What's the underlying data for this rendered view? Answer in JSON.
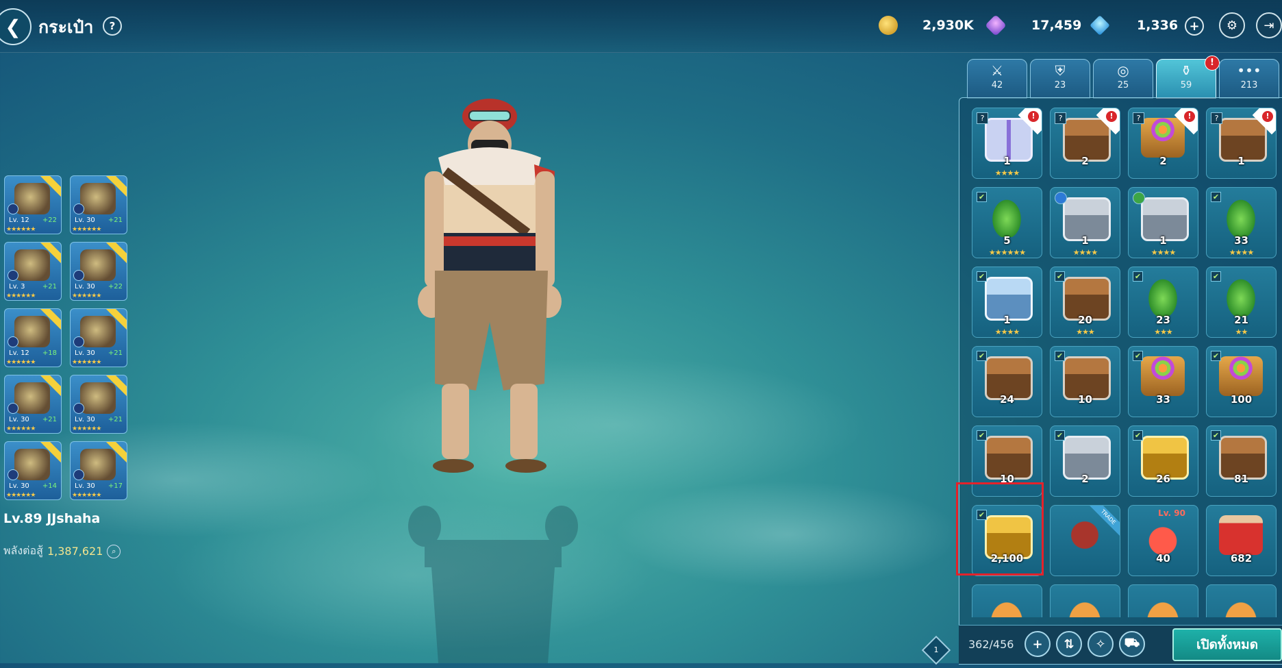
{
  "header": {
    "title": "กระเป๋า",
    "back_icon": "arrow-left-icon",
    "help_label": "?"
  },
  "currencies": [
    {
      "name": "gold",
      "value": "2,930K",
      "icon": "gold-coin-icon"
    },
    {
      "name": "crystal",
      "value": "17,459",
      "icon": "purple-crystal-icon"
    },
    {
      "name": "diamond",
      "value": "1,336",
      "icon": "blue-diamond-icon"
    }
  ],
  "header_buttons": {
    "plus": "+",
    "settings_icon": "gear-icon",
    "exit_icon": "exit-icon"
  },
  "player": {
    "name": "Lv.89 JJshaha",
    "power_label": "พลังต่อสู้",
    "power_value": "1,387,621"
  },
  "equipment": [
    {
      "lv": "Lv. 12",
      "plus": "+22",
      "stars": "★★★★★★"
    },
    {
      "lv": "Lv. 30",
      "plus": "+21",
      "stars": "★★★★★★"
    },
    {
      "lv": "Lv. 3",
      "plus": "+21",
      "stars": "★★★★★★"
    },
    {
      "lv": "Lv. 30",
      "plus": "+22",
      "stars": "★★★★★★"
    },
    {
      "lv": "Lv. 12",
      "plus": "+18",
      "stars": "★★★★★★"
    },
    {
      "lv": "Lv. 30",
      "plus": "+21",
      "stars": "★★★★★★"
    },
    {
      "lv": "Lv. 30",
      "plus": "+21",
      "stars": "★★★★★★"
    },
    {
      "lv": "Lv. 30",
      "plus": "+21",
      "stars": "★★★★★★"
    },
    {
      "lv": "Lv. 30",
      "plus": "+14",
      "stars": "★★★★★★"
    },
    {
      "lv": "Lv. 30",
      "plus": "+17",
      "stars": "★★★★★★"
    }
  ],
  "tabs": [
    {
      "icon": "sword-icon",
      "count": "42"
    },
    {
      "icon": "shield-icon",
      "count": "23"
    },
    {
      "icon": "ring-icon",
      "count": "25"
    },
    {
      "icon": "potion-icon",
      "count": "59",
      "active": true,
      "alert": "!"
    },
    {
      "icon": "more-icon",
      "count": "213"
    }
  ],
  "inventory": [
    {
      "art": "gift",
      "count": "1",
      "stars": "★★★★",
      "mark": "?",
      "alert": "!"
    },
    {
      "art": "chest",
      "count": "2",
      "stars": "",
      "mark": "?",
      "alert": "!"
    },
    {
      "art": "basket",
      "count": "2",
      "stars": "",
      "mark": "?",
      "alert": "!"
    },
    {
      "art": "chest",
      "count": "1",
      "stars": "",
      "mark": "?",
      "alert": "!"
    },
    {
      "art": "bean",
      "count": "5",
      "stars": "★★★★★★",
      "mark": "✔"
    },
    {
      "art": "silverchest",
      "count": "1",
      "stars": "★★★★",
      "mark": "water"
    },
    {
      "art": "silverchest",
      "count": "1",
      "stars": "★★★★",
      "mark": "leaf"
    },
    {
      "art": "bean",
      "count": "33",
      "stars": "★★★★",
      "mark": "✔"
    },
    {
      "art": "bluechest",
      "count": "1",
      "stars": "★★★★",
      "mark": "✔"
    },
    {
      "art": "chest",
      "count": "20",
      "stars": "★★★",
      "mark": "✔"
    },
    {
      "art": "bean",
      "count": "23",
      "stars": "★★★",
      "mark": "✔"
    },
    {
      "art": "bean",
      "count": "21",
      "stars": "★★",
      "mark": "✔"
    },
    {
      "art": "chest",
      "count": "24",
      "stars": "",
      "mark": "✔"
    },
    {
      "art": "chest",
      "count": "10",
      "stars": "",
      "mark": "✔"
    },
    {
      "art": "basket",
      "count": "33",
      "stars": "",
      "mark": "✔"
    },
    {
      "art": "basket",
      "count": "100",
      "stars": "",
      "mark": "✔"
    },
    {
      "art": "chest",
      "count": "10",
      "stars": "",
      "mark": "✔"
    },
    {
      "art": "silverchest",
      "count": "2",
      "stars": "",
      "mark": "✔"
    },
    {
      "art": "goldchest",
      "count": "26",
      "stars": "",
      "mark": "✔"
    },
    {
      "art": "chest",
      "count": "81",
      "stars": "",
      "mark": "✔"
    },
    {
      "art": "goldchest",
      "count": "2,100",
      "stars": "",
      "mark": "✔",
      "selected": true
    },
    {
      "art": "bow",
      "count": "",
      "stars": "",
      "trade": "TRADE"
    },
    {
      "art": "potion",
      "count": "40",
      "stars": "",
      "lvtag": "Lv. 90"
    },
    {
      "art": "jar",
      "count": "682",
      "stars": ""
    },
    {
      "art": "food",
      "count": "",
      "stars": ""
    },
    {
      "art": "food",
      "count": "",
      "stars": ""
    },
    {
      "art": "food",
      "count": "",
      "stars": ""
    },
    {
      "art": "food",
      "count": "",
      "stars": ""
    }
  ],
  "footer": {
    "capacity": "362/456",
    "open_all_label": "เปิดทั้งหมด"
  },
  "page_indicator": "1"
}
